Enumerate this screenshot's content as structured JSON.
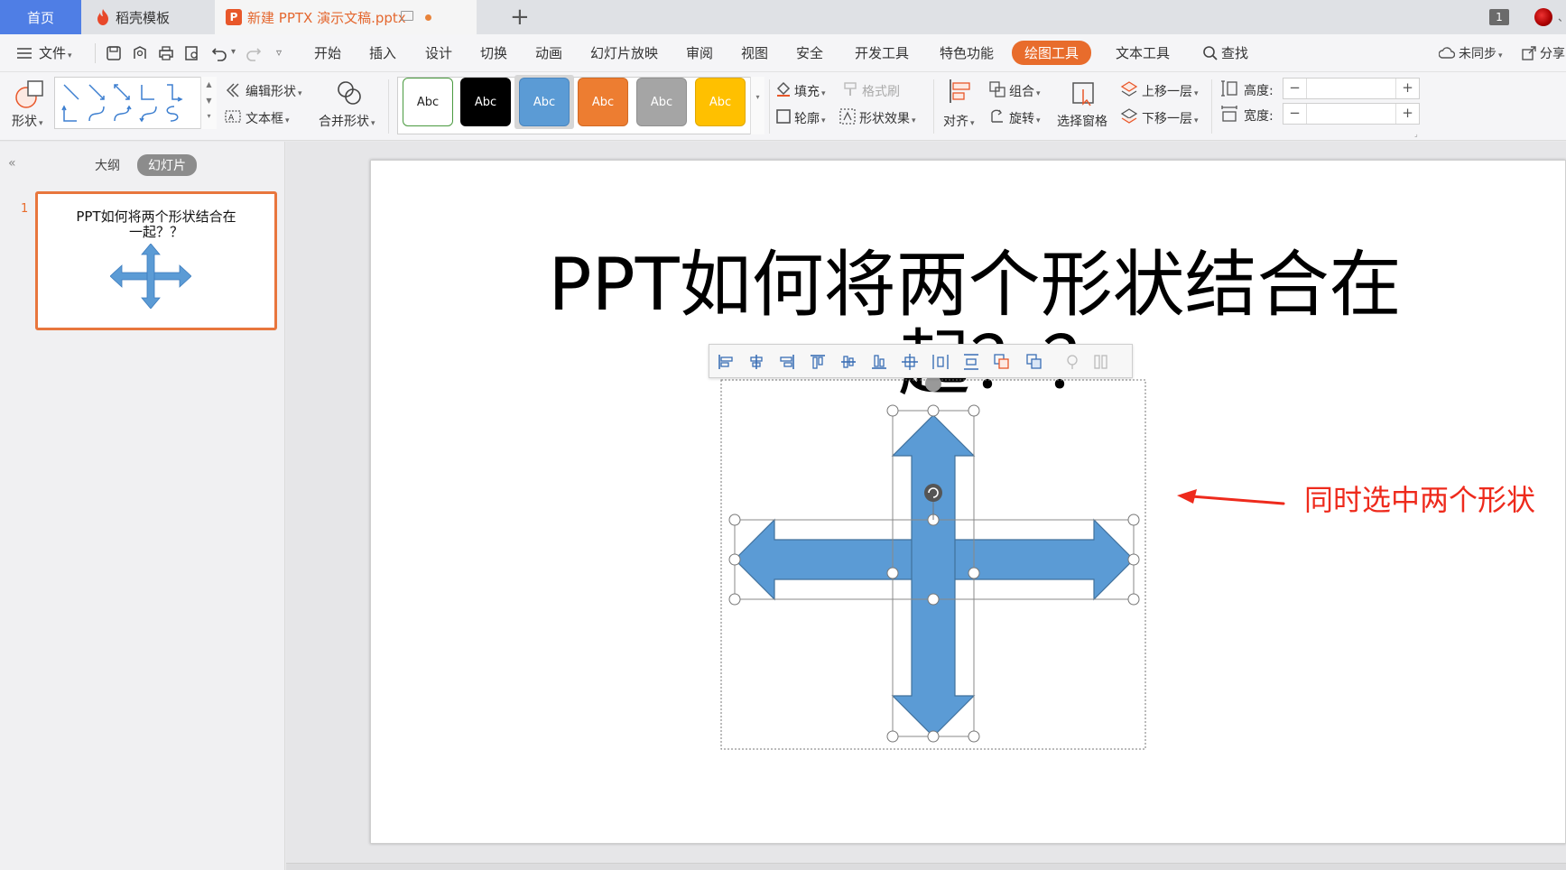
{
  "tabs": {
    "home": "首页",
    "template": "稻壳模板",
    "document": "新建 PPTX 演示文稿.pptx",
    "window_count": "1"
  },
  "menu": {
    "file": "文件",
    "items": [
      "开始",
      "插入",
      "设计",
      "切换",
      "动画",
      "幻灯片放映",
      "审阅",
      "视图",
      "安全",
      "开发工具",
      "特色功能",
      "绘图工具",
      "文本工具"
    ],
    "active": "绘图工具",
    "search": "查找",
    "sync": "未同步",
    "share": "分享"
  },
  "ribbon": {
    "shape": "形状",
    "edit_shape": "编辑形状",
    "text_box": "文本框",
    "merge_shape": "合并形状",
    "style_samples": [
      "Abc",
      "Abc",
      "Abc",
      "Abc",
      "Abc",
      "Abc"
    ],
    "fill": "填充",
    "format_painter": "格式刷",
    "outline": "轮廓",
    "shape_effect": "形状效果",
    "align": "对齐",
    "group": "组合",
    "rotate": "旋转",
    "selection_pane": "选择窗格",
    "bring_forward": "上移一层",
    "send_backward": "下移一层",
    "height_label": "高度:",
    "width_label": "宽度:",
    "height_value": "",
    "width_value": "",
    "minus": "−",
    "plus": "+"
  },
  "left_panel": {
    "outline_tab": "大纲",
    "slides_tab": "幻灯片",
    "slide_number": "1",
    "thumb_title_line1": "PPT如何将两个形状结合在",
    "thumb_title_line2": "一起？？"
  },
  "slide": {
    "title_line1": "PPT如何将两个形状结合在",
    "title_line2": "起？？",
    "annotation": "同时选中两个形状",
    "shape_color": "#5b9bd5"
  },
  "colors": {
    "accent": "#e86c2c",
    "home_tab": "#4f7ee5",
    "annotation": "#ee2a1c"
  }
}
